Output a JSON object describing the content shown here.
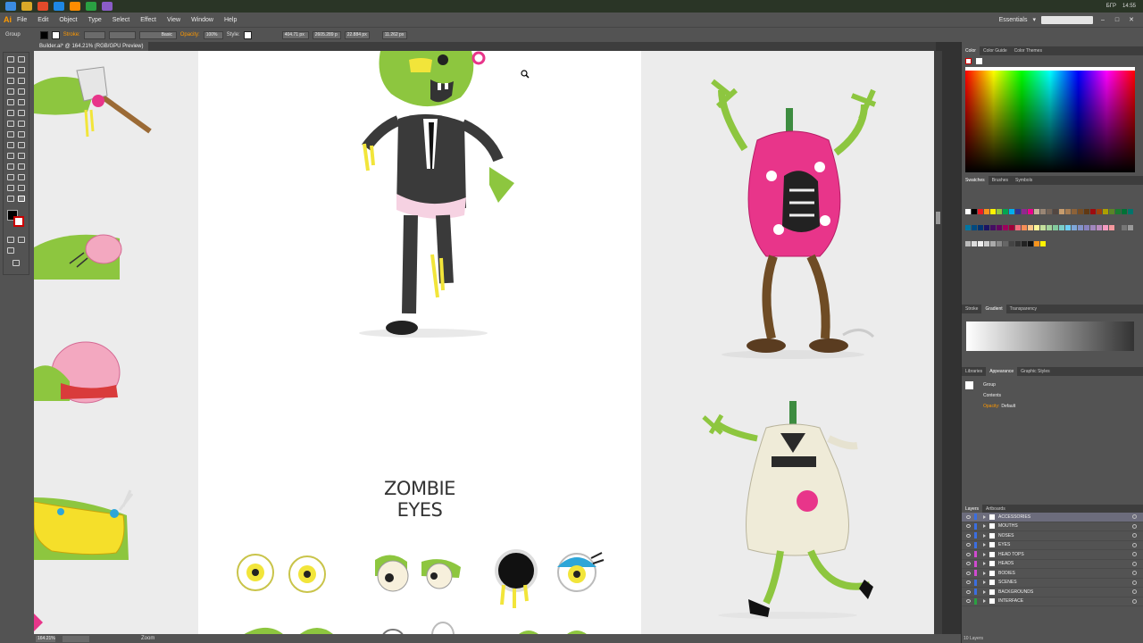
{
  "taskbar": {
    "clock": "14:55",
    "language": "БГР"
  },
  "app": {
    "logo": "Ai",
    "workspace": "Essentials"
  },
  "menu": [
    "File",
    "Edit",
    "Object",
    "Type",
    "Select",
    "Effect",
    "View",
    "Window",
    "Help"
  ],
  "control": {
    "selection_label": "Group",
    "stroke_label": "Stroke:",
    "brush_value": "Basic",
    "opacity_label": "Opacity:",
    "opacity_value": "100%",
    "style_label": "Style:",
    "x_value": "404.71 px",
    "y_value": "2605.289 p",
    "w_value": "22.884 px",
    "h_value": "11.262 px"
  },
  "document": {
    "tab": "Builder.ai* @ 164.21% (RGB/GPU Preview)"
  },
  "panels": {
    "color_tabs": [
      "Color",
      "Color Guide",
      "Color Themes"
    ],
    "swatch_tabs": [
      "Swatches",
      "Brushes",
      "Symbols"
    ],
    "gradient_tabs": [
      "Stroke",
      "Gradient",
      "Transparency"
    ],
    "appearance_tabs": [
      "Libraries",
      "Appearance",
      "Graphic Styles"
    ],
    "appearance": {
      "object": "Group",
      "contents": "Contents",
      "opacity_label": "Opacity:",
      "opacity_value": "Default"
    },
    "layers_tabs": [
      "Layers",
      "Artboards"
    ],
    "layers": [
      "ACCESSORIES",
      "MOUTHS",
      "NOSES",
      "EYES",
      "HEAD TOPS",
      "HEADS",
      "BODIES",
      "SCENES",
      "BACKGROUNDS",
      "INTERFACE"
    ],
    "layers_count": "10 Layers"
  },
  "status": {
    "zoom": "164.21%",
    "tool": "Zoom"
  },
  "artwork": {
    "section_heading": "ZOMBIE EYES"
  },
  "colors": {
    "zombie_green": "#8dc63f",
    "dark_suit": "#3a3a3a",
    "pink": "#e8358a",
    "brain_pink": "#f3a8c0",
    "eye_yellow": "#f2e53a",
    "accent_blue": "#2ea6d8"
  },
  "icons": [
    "ai-logo",
    "search-icon",
    "minimize-icon",
    "maximize-icon",
    "close-icon",
    "eye-icon",
    "zoom-cursor-icon"
  ]
}
